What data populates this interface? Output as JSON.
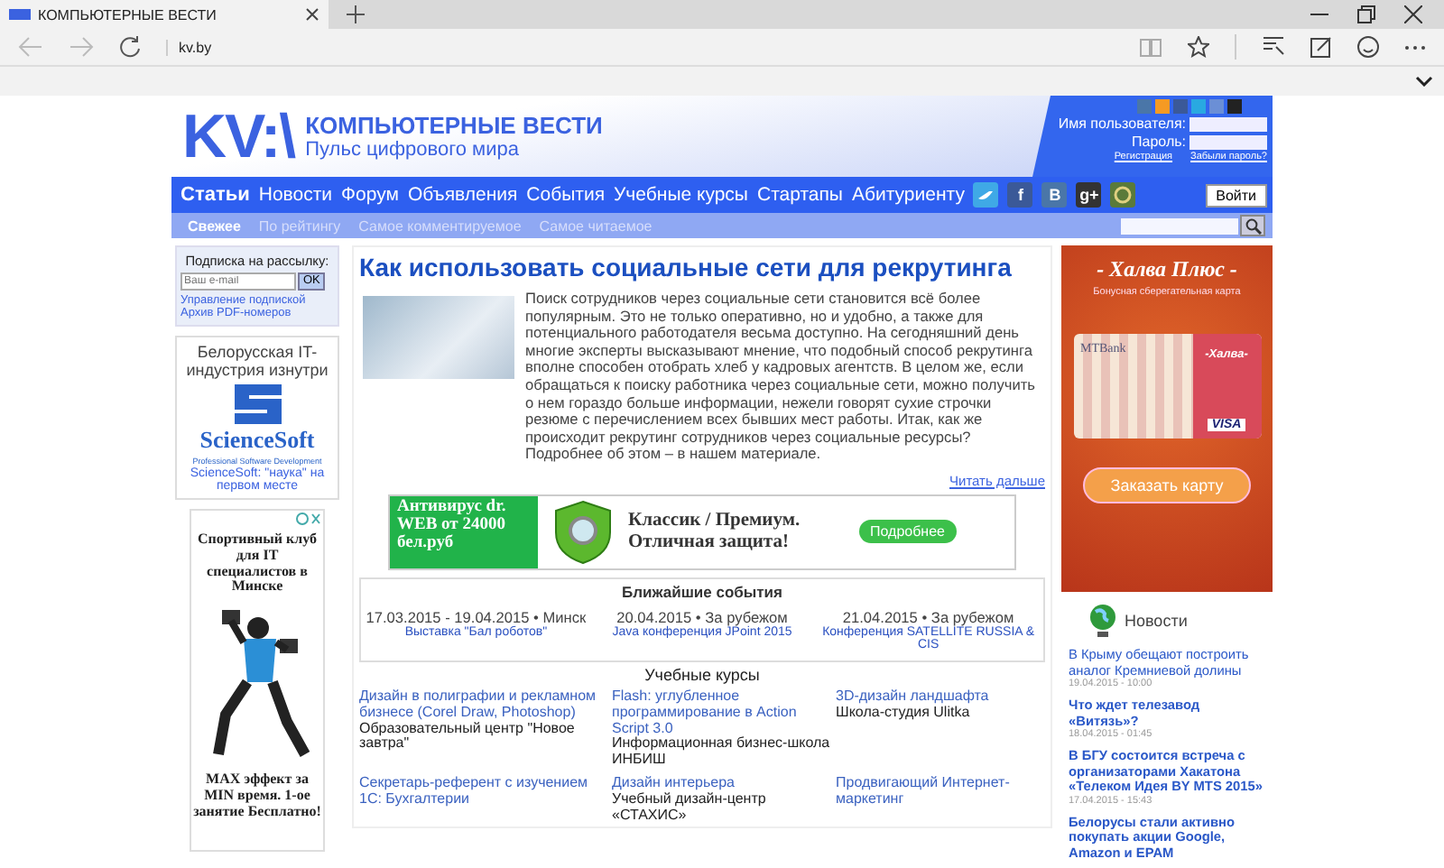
{
  "browser": {
    "tab_title": "КОМПЬЮТЕРНЫЕ ВЕСТИ",
    "url": "kv.by"
  },
  "header": {
    "logo": "KV:\\",
    "site_title": "КОМПЬЮТЕРНЫЕ ВЕСТИ",
    "tagline": "Пульс цифрового мира",
    "share_icons": [
      {
        "color": "#4a76a8"
      },
      {
        "color": "#f59a23"
      },
      {
        "color": "#3b5998"
      },
      {
        "color": "#29a9e1"
      },
      {
        "color": "#6b8fd6"
      },
      {
        "color": "#222222"
      }
    ]
  },
  "login": {
    "username_label": "Имя пользователя:",
    "password_label": "Пароль:",
    "register_link": "Регистрация",
    "forgot_link": "Забыли пароль?",
    "submit": "Войти"
  },
  "nav": [
    {
      "label": "Статьи",
      "selected": true
    },
    {
      "label": "Новости",
      "selected": false
    },
    {
      "label": "Форум",
      "selected": false
    },
    {
      "label": "Объявления",
      "selected": false
    },
    {
      "label": "События",
      "selected": false
    },
    {
      "label": "Учебные курсы",
      "selected": false
    },
    {
      "label": "Стартапы",
      "selected": false
    },
    {
      "label": "Абитуриенту",
      "selected": false
    }
  ],
  "nav_social": [
    {
      "kind": "bird",
      "color": "#3fa9e6"
    },
    {
      "kind": "glyph",
      "glyph": "f",
      "color": "#3b5998"
    },
    {
      "kind": "glyph",
      "glyph": "B",
      "color": "#4a76a8"
    },
    {
      "kind": "glyph",
      "glyph": "g+",
      "color": "#333333"
    },
    {
      "kind": "ring",
      "color": "#5a7a3a"
    }
  ],
  "subnav": [
    {
      "label": "Свежее",
      "selected": true
    },
    {
      "label": "По рейтингу",
      "selected": false
    },
    {
      "label": "Самое комментируемое",
      "selected": false
    },
    {
      "label": "Самое читаемое",
      "selected": false
    }
  ],
  "subscribe": {
    "title": "Подписка на рассылку:",
    "placeholder": "Ваш e-mail",
    "submit": "OK",
    "links": [
      "Управление подпиской",
      "Архив PDF-номеров"
    ]
  },
  "promo": {
    "heading": "Белорусская IT-индустрия изнутри",
    "brand": "ScienceSoft",
    "brand_sub": "Professional Software Development",
    "caption": "ScienceSoft: \"наука\" на первом месте"
  },
  "left_ad": {
    "headline": "Спортивный клуб для IT специалистов в Минске",
    "footer": "MAX эффект за MIN время. 1-ое занятие Бесплатно!"
  },
  "article": {
    "title": "Как использовать социальные сети для рекрутинга",
    "text": "Поиск сотрудников через социальные сети становится всё более популярным. Это не только оперативно, но и удобно, а также для потенциального работодателя весьма доступно. На сегодняшний день многие эксперты высказывают мнение, что подобный способ рекрутинга вполне способен отобрать хлеб у кадровых агентств.  В целом же, если обращаться к поиску работника через социальные сети, можно получить о нем гораздо больше информации, нежели говорят  сухие строчки резюме с перечислением всех бывших мест работы. Итак, как же происходит рекрутинг сотрудников через социальные ресурсы? Подробнее об этом – в нашем материале.",
    "more": "Читать дальше"
  },
  "banner": {
    "left": "Антивирус dr. WEB от 24000 бел.руб",
    "right": "Классик / Премиум. Отличная защита!",
    "button": "Подробнее"
  },
  "events": {
    "title": "Ближайшие события",
    "items": [
      {
        "when": "17.03.2015 - 19.04.2015 • Минск",
        "name": "Выставка \"Бал роботов\""
      },
      {
        "when": "20.04.2015 • За рубежом",
        "name": "Java конференция JPoint 2015"
      },
      {
        "when": "21.04.2015 • За рубежом",
        "name": "Конференция SATELLITE RUSSIA & CIS"
      }
    ]
  },
  "courses": {
    "title": "Учебные курсы",
    "items": [
      {
        "name": "Дизайн в полиграфии и рекламном бизнесе (Corel Draw, Photoshop)",
        "school": "Образовательный центр \"Новое завтра\""
      },
      {
        "name": "Flash: углубленное программирование в Action Script 3.0",
        "school": "Информационная бизнес-школа ИНБИШ"
      },
      {
        "name": "3D-дизайн ландшафта",
        "school": "Школа-студия Ulitka"
      },
      {
        "name": "Секретарь-референт с изучением 1С: Бухгалтерии"
      },
      {
        "name": "Дизайн интерьера",
        "school": "Учебный дизайн-центр «СТАХИС»"
      },
      {
        "name": "Продвигающий Интернет-маркетинг"
      }
    ]
  },
  "right_ad": {
    "title": "- Халва Плюс -",
    "subtitle": "Бонусная сберегательная карта",
    "bank": "MTBank",
    "card_name": "-Халва-",
    "network": "VISA",
    "button": "Заказать карту"
  },
  "news": {
    "title": "Новости",
    "items": [
      {
        "headline": "В Крыму обещают построить аналог Кремниевой долины",
        "time": "19.04.2015 - 10:00",
        "bold": false
      },
      {
        "headline": "Что ждет телезавод «Витязь»?",
        "time": "18.04.2015 - 01:45",
        "bold": true
      },
      {
        "headline": "В БГУ состоится встреча с организаторами Хакатона «Телеком Идея BY MTS 2015»",
        "time": "17.04.2015 - 15:43",
        "bold": true
      },
      {
        "headline": "Белорусы стали активно покупать акции Google, Amazon и EPAM",
        "bold": true
      }
    ]
  }
}
